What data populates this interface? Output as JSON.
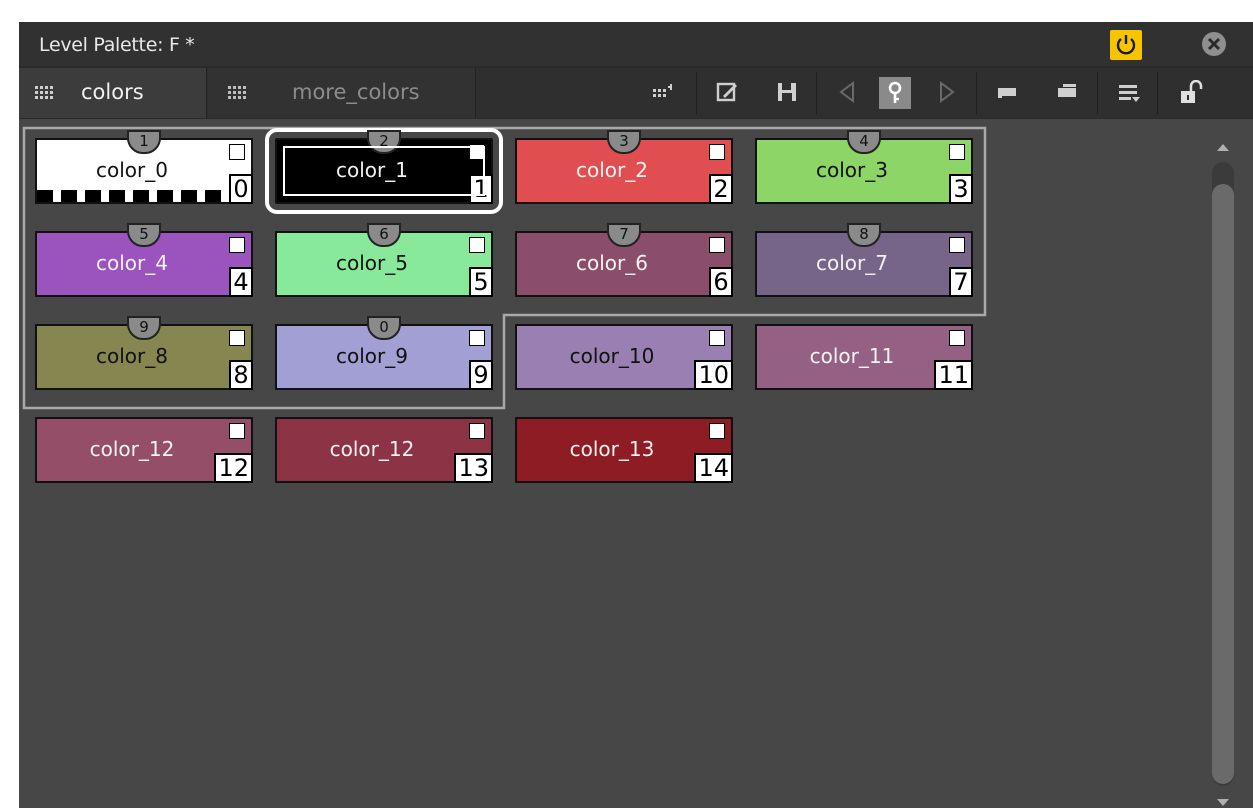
{
  "window": {
    "title": "Level Palette: F *",
    "power_icon": "power-icon",
    "close_icon": "close-icon",
    "accent_color": "#f6c500"
  },
  "tabs": [
    {
      "label": "colors",
      "icon": "grid-icon",
      "active": true
    },
    {
      "label": "more_colors",
      "icon": "grid-icon",
      "active": false
    }
  ],
  "toolbar": [
    "view-mode-icon",
    "edit-icon",
    "save-icon",
    "prev-key-icon",
    "key-icon",
    "next-key-icon",
    "new-page-icon",
    "new-page-from-selection-icon",
    "menu-options-icon",
    "lock-icon"
  ],
  "chips": [
    {
      "name": "color_0",
      "index": "0",
      "style": "1",
      "color": "#ffffff",
      "light": true
    },
    {
      "name": "color_1",
      "index": "1",
      "style": "2",
      "color": "#000000",
      "selected": true
    },
    {
      "name": "color_2",
      "index": "2",
      "style": "3",
      "color": "#e14e52"
    },
    {
      "name": "color_3",
      "index": "3",
      "style": "4",
      "color": "#8cd566",
      "light": true
    },
    {
      "name": "color_4",
      "index": "4",
      "style": "5",
      "color": "#9b53bd"
    },
    {
      "name": "color_5",
      "index": "5",
      "style": "6",
      "color": "#88e99a",
      "light": true
    },
    {
      "name": "color_6",
      "index": "6",
      "style": "7",
      "color": "#8a4d6a"
    },
    {
      "name": "color_7",
      "index": "7",
      "style": "8",
      "color": "#776489"
    },
    {
      "name": "color_8",
      "index": "8",
      "style": "9",
      "color": "#868650",
      "light": true
    },
    {
      "name": "color_9",
      "index": "9",
      "style": "0",
      "color": "#a29fd4",
      "light": true
    },
    {
      "name": "color_10",
      "index": "10",
      "color": "#9a80b2",
      "light": true
    },
    {
      "name": "color_11",
      "index": "11",
      "color": "#946185"
    },
    {
      "name": "color_12",
      "index": "12",
      "color": "#944e68"
    },
    {
      "name": "color_12",
      "index": "13",
      "color": "#8c3346"
    },
    {
      "name": "color_13",
      "index": "14",
      "color": "#8d1c24"
    }
  ]
}
